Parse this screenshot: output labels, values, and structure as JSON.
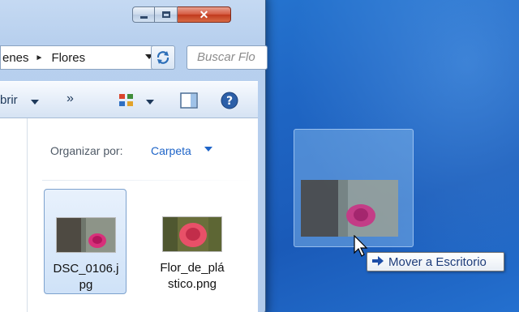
{
  "window": {
    "buttons": {
      "minimize": "minimize",
      "maximize": "maximize",
      "close": "✕"
    }
  },
  "address_bar": {
    "crumbs": [
      "enes",
      "Flores"
    ],
    "separator": "►"
  },
  "search": {
    "placeholder": "Buscar Flo"
  },
  "toolbar": {
    "open_label": "brir",
    "more_label": "»",
    "icons": [
      "change-view-icon",
      "preview-pane-icon",
      "help-icon"
    ]
  },
  "arrange": {
    "label": "Organizar por:",
    "value": "Carpeta"
  },
  "files": [
    {
      "name_line1": "DSC_0106.j",
      "name_line2": "pg",
      "selected": true
    },
    {
      "name_line1": "Flor_de_plá",
      "name_line2": "stico.png",
      "selected": false
    }
  ],
  "drag": {
    "tooltip": "Mover a Escritorio",
    "tooltip_icon": "arrow-right-icon"
  },
  "colors": {
    "desktop": "#1f66c4",
    "link_blue": "#1e64c8",
    "close_red": "#c0391d"
  }
}
